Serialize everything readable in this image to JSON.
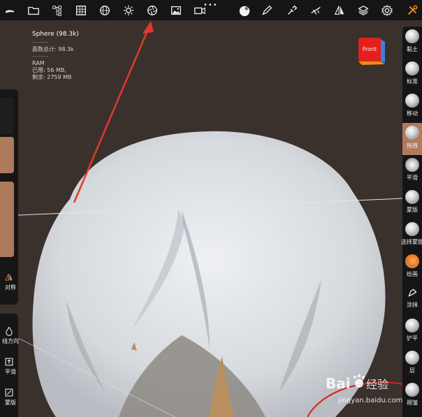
{
  "info": {
    "mesh_name": "Sphere (98.3k)",
    "separator": "--------",
    "face_total": "面数总计:  98.3k",
    "ram_label": "RAM",
    "ram_used": "已用:   56 MB,",
    "ram_free": "剩余:   2759 MB"
  },
  "cube": {
    "label": "Front",
    "front_color": "#e3201b",
    "side_color": "#3d7fe0",
    "bottom_color": "#f08a1c"
  },
  "topbar": {
    "more": "•••",
    "icons": [
      "brush-stroke-icon",
      "folder-icon",
      "scene-tree-icon",
      "grid-icon",
      "sphere-wire-icon",
      "light-icon",
      "camera-aperture-icon",
      "image-icon",
      "video-icon",
      "material-ball-icon",
      "pen-icon",
      "eyedropper-icon",
      "stroke-smooth-icon",
      "symmetry-icon",
      "layers-icon",
      "settings-gear-icon",
      "tools-icon"
    ]
  },
  "left_panel": {
    "symmetry_label": "对称",
    "line_direction_label": "线方向",
    "smooth_label": "平滑",
    "mask_label": "蒙版",
    "swatch_color": "#ad7a5c"
  },
  "brushes": [
    {
      "label": "黏土",
      "active": false
    },
    {
      "label": "标准",
      "active": false
    },
    {
      "label": "移动",
      "active": false
    },
    {
      "label": "拖拽",
      "active": true
    },
    {
      "label": "平滑",
      "active": false
    },
    {
      "label": "蒙版",
      "active": false
    },
    {
      "label": "选择蒙版",
      "active": false
    },
    {
      "label": "绘画",
      "active": false
    },
    {
      "label": "涂抹",
      "active": false
    },
    {
      "label": "铲平",
      "active": false
    },
    {
      "label": "层",
      "active": false
    },
    {
      "label": "褶皱",
      "active": false
    }
  ],
  "watermark": {
    "brand": "Bai",
    "brand2": "经验",
    "url": "jingyan.baidu.com"
  },
  "colors": {
    "background": "#3a302c",
    "toolbar": "#151515",
    "accent": "#b07a5c",
    "arrow": "#e23a2a"
  }
}
